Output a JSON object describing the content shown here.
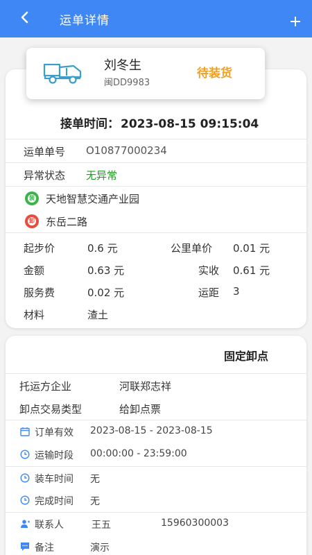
{
  "header": {
    "title": "运单详情",
    "back_icon": "chevron-left-icon",
    "add_icon": "plus-icon"
  },
  "driver": {
    "name": "刘冬生",
    "plate": "闽DD9983",
    "status": "待装货",
    "status_color": "#f0a020",
    "icon": "truck-icon"
  },
  "accept": {
    "label": "接单时间：",
    "time": "2023-08-15 09:15:04"
  },
  "order": {
    "number_label": "运单单号",
    "number_value": "O10877000234",
    "abnormal_label": "异常状态",
    "abnormal_value": "无异常"
  },
  "route": {
    "load_icon_text": "装",
    "load_place": "天地智慧交通产业园",
    "unload_icon_text": "卸",
    "unload_place": "东岳二路"
  },
  "fees": {
    "start_price_label": "起步价",
    "start_price_value": "0.6 元",
    "unit_price_label": "公里单价",
    "unit_price_value": "0.01 元",
    "amount_label": "金额",
    "amount_value": "0.63 元",
    "received_label": "实收",
    "received_value": "0.61 元",
    "service_label": "服务费",
    "service_value": "0.02 元",
    "distance_label": "运距",
    "distance_value": "3",
    "material_label": "材料",
    "material_value": "渣土"
  },
  "unload": {
    "title": "固定卸点",
    "company_label": "托运方企业",
    "company_value": "河联郑志祥",
    "trade_label": "卸点交易类型",
    "trade_value": "给卸点票"
  },
  "schedule": {
    "valid_label": "订单有效",
    "valid_value": "2023-08-15 - 2023-08-15",
    "transport_label": "运输时段",
    "transport_value": "00:00:00 - 23:59:00",
    "loading_label": "装车时间",
    "loading_value": "无",
    "finish_label": "完成时间",
    "finish_value": "无"
  },
  "contact": {
    "person_label": "联系人",
    "person_name": "王五",
    "person_phone": "15960300003",
    "remark_label": "备注",
    "remark_value": "演示"
  },
  "colors": {
    "primary": "#3f87f5",
    "accent": "#f0a020",
    "ok": "#1e9a1e",
    "load_icon": "#3bb34a",
    "unload_icon": "#e74c3c"
  }
}
